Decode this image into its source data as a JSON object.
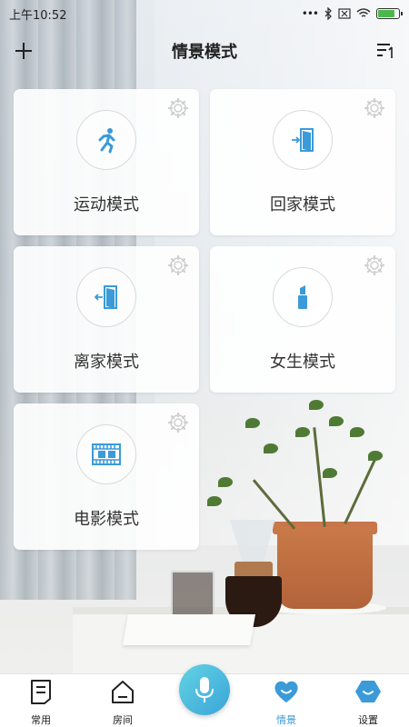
{
  "status_bar": {
    "time": "上午10:52"
  },
  "header": {
    "title": "情景模式",
    "add_icon": "plus-icon",
    "sort_icon": "sort-icon"
  },
  "scenes": [
    {
      "label": "运动模式",
      "icon": "running-person-icon"
    },
    {
      "label": "回家模式",
      "icon": "door-enter-icon"
    },
    {
      "label": "离家模式",
      "icon": "door-exit-icon"
    },
    {
      "label": "女生模式",
      "icon": "lipstick-icon"
    },
    {
      "label": "电影模式",
      "icon": "film-icon"
    }
  ],
  "tabbar": {
    "items": [
      {
        "label": "常用",
        "icon": "note-icon",
        "active": false
      },
      {
        "label": "房间",
        "icon": "house-icon",
        "active": false
      },
      {
        "label": "情景",
        "icon": "heart-smile-icon",
        "active": true
      },
      {
        "label": "设置",
        "icon": "hexagon-smile-icon",
        "active": false
      }
    ],
    "mic_icon": "microphone-icon"
  },
  "colors": {
    "accent": "#3b9ad8",
    "mic_gradient_start": "#62d3e4",
    "mic_gradient_end": "#3ba4d8"
  }
}
